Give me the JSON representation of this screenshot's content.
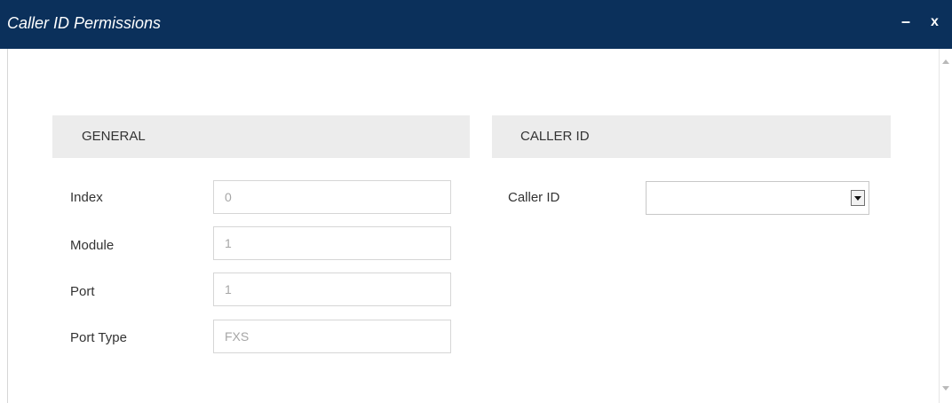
{
  "window": {
    "title": "Caller ID Permissions",
    "minimize_label": "–",
    "close_label": "x"
  },
  "general": {
    "header": "GENERAL",
    "fields": [
      {
        "label": "Index",
        "value": "0"
      },
      {
        "label": "Module",
        "value": "1"
      },
      {
        "label": "Port",
        "value": "1"
      },
      {
        "label": "Port Type",
        "value": "FXS"
      }
    ]
  },
  "caller_id": {
    "header": "CALLER ID",
    "label": "Caller ID",
    "selected_value": ""
  },
  "colors": {
    "titlebar": "#0b305b",
    "section_header_bg": "#ececec",
    "field_border": "#d6d6d6"
  }
}
